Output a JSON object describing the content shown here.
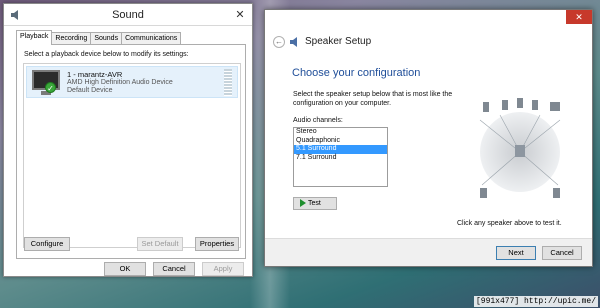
{
  "sound_window": {
    "title": "Sound",
    "tabs": [
      {
        "label": "Playback",
        "active": true
      },
      {
        "label": "Recording",
        "active": false
      },
      {
        "label": "Sounds",
        "active": false
      },
      {
        "label": "Communications",
        "active": false
      }
    ],
    "instruction": "Select a playback device below to modify its settings:",
    "device": {
      "name": "1 - marantz-AVR",
      "description": "AMD High Definition Audio Device",
      "state": "Default Device",
      "icon": "monitor-speaker-icon"
    },
    "buttons": {
      "configure": "Configure",
      "set_default": "Set Default",
      "properties": "Properties",
      "ok": "OK",
      "cancel": "Cancel",
      "apply": "Apply"
    }
  },
  "speaker_setup": {
    "title": "Speaker Setup",
    "heading": "Choose your configuration",
    "description": "Select the speaker setup below that is most like the configuration on your computer.",
    "channels_label": "Audio channels:",
    "channels": [
      "Stereo",
      "Quadraphonic",
      "5.1 Surround",
      "7.1 Surround"
    ],
    "selected_channel": "5.1 Surround",
    "test_label": "Test",
    "hint": "Click any speaker above to test it.",
    "next_label": "Next",
    "cancel_label": "Cancel",
    "accent": "#1f4e99"
  },
  "watermark": "[991x477] http://upic.me/"
}
